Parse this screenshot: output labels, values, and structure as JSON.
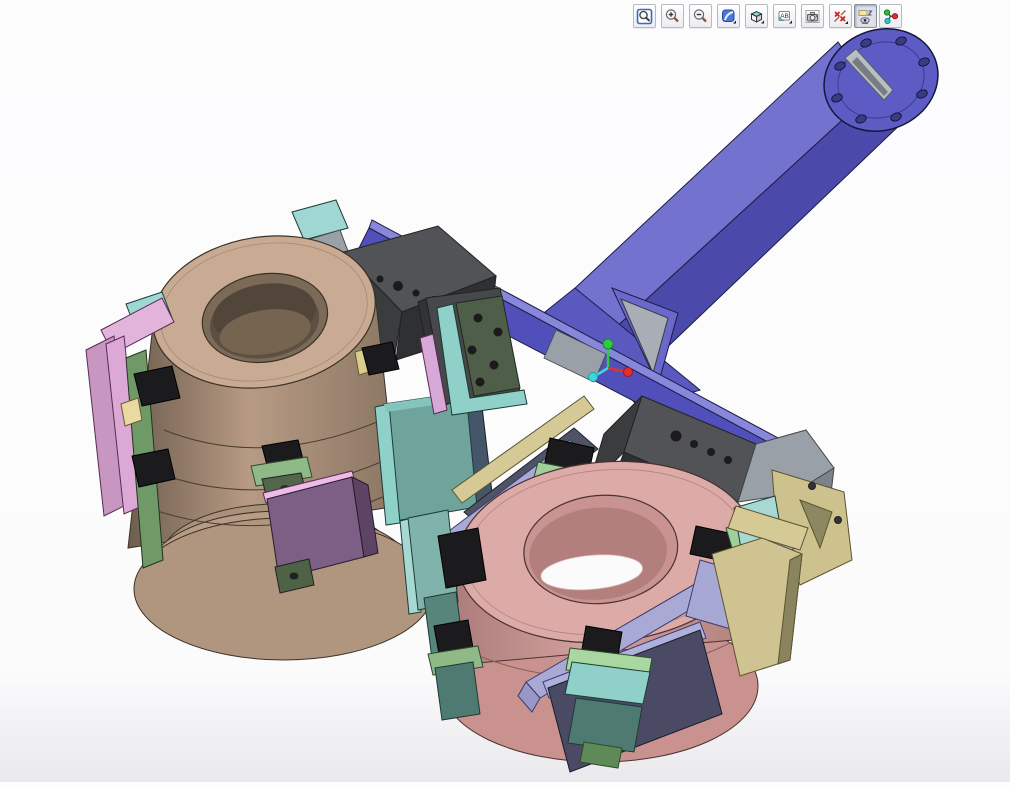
{
  "toolbar": {
    "annotation_icon_text": "AB",
    "buttons": [
      {
        "name": "zoom-window",
        "icon": "magnifier-box-icon",
        "pressed": false
      },
      {
        "name": "zoom-in",
        "icon": "magnifier-plus-icon",
        "pressed": false
      },
      {
        "name": "zoom-out",
        "icon": "magnifier-minus-icon",
        "pressed": false
      },
      {
        "name": "shaded-view",
        "icon": "blue-brush-square-icon",
        "pressed": false,
        "has_dropdown": true
      },
      {
        "name": "view-orientation",
        "icon": "cube-icon",
        "pressed": false,
        "has_dropdown": true
      },
      {
        "name": "annotations",
        "icon": "ab-tag-icon",
        "pressed": false,
        "has_dropdown": true
      },
      {
        "name": "snapshot",
        "icon": "camera-icon",
        "pressed": false
      },
      {
        "name": "hide-dimensions",
        "icon": "crossed-x-icon",
        "pressed": false,
        "has_dropdown": true
      },
      {
        "name": "markup-visibility",
        "icon": "tag-eye-icon",
        "pressed": true
      },
      {
        "name": "coordinate-triad",
        "icon": "triad-spheres-icon",
        "pressed": false
      }
    ]
  },
  "viewport": {
    "background": "#fbfbfc",
    "bottom_tint": "#e9e9ed"
  },
  "scene": {
    "parts": [
      {
        "name": "boom-arm",
        "color": "#5d5cc4"
      },
      {
        "name": "mount-flange",
        "color": "#5d5cc4"
      },
      {
        "name": "crossbar",
        "color": "#5150ba"
      },
      {
        "name": "gripper-body",
        "color": "#515356"
      },
      {
        "name": "workpiece-cone-left",
        "color": "#c9ab94"
      },
      {
        "name": "workpiece-cone-right",
        "color": "#dcaba8"
      },
      {
        "name": "finger-bracket-pink",
        "color": "#c897c1"
      },
      {
        "name": "finger-bar-green",
        "color": "#6f9a68"
      },
      {
        "name": "finger-plate-teal",
        "color": "#6fa49c"
      },
      {
        "name": "frame-rail-lavender",
        "color": "#a9a9d6"
      },
      {
        "name": "frame-rail-khaki",
        "color": "#cfc491"
      },
      {
        "name": "contact-pad-black",
        "color": "#1b1b1d"
      }
    ],
    "origin_triad": {
      "x_color": "#e23030",
      "y_color": "#2ecc40",
      "z_color": "#3cd8dc"
    },
    "colors": {
      "boom-light": "#7372cf",
      "boom-dark": "#4b4aab",
      "boom-flange": "#5d5cc4",
      "bar-face": "#5150ba",
      "bar-top": "#8787dc",
      "block-top": "#515356",
      "block-side": "#3a3c3e",
      "block-front": "#2e3032",
      "metal-gray": "#9aa0a8",
      "cone-left-top": "#c9ab94",
      "cone-right-top": "#dcaba8",
      "cone-right-base": "#c9928f",
      "pad": "#1b1b1d",
      "pink": "#c897c1",
      "pink-light": "#e2b4dc",
      "purple-plate": "#7d5e85",
      "green-bar": "#6f9a68",
      "green-cap": "#8fba88",
      "green-dark": "#52664b",
      "green-plate": "#4e5e48",
      "teal": "#6fa49c",
      "teal-light": "#9fd8d2",
      "teal-pale": "#a8d8d2",
      "teal-bright": "#8fd0c8",
      "teal-deep": "#4e7a72",
      "lavender": "#a9a9d6",
      "lavender-light": "#b0b0dc",
      "khaki": "#cfc491",
      "khaki-light": "#d5ca96",
      "khaki-dark": "#8a845e",
      "slate": "#4a4a64",
      "slate-band": "#4e5366",
      "triad-x": "#e23030",
      "triad-y": "#2ecc40",
      "triad-z": "#3cd8dc"
    }
  }
}
